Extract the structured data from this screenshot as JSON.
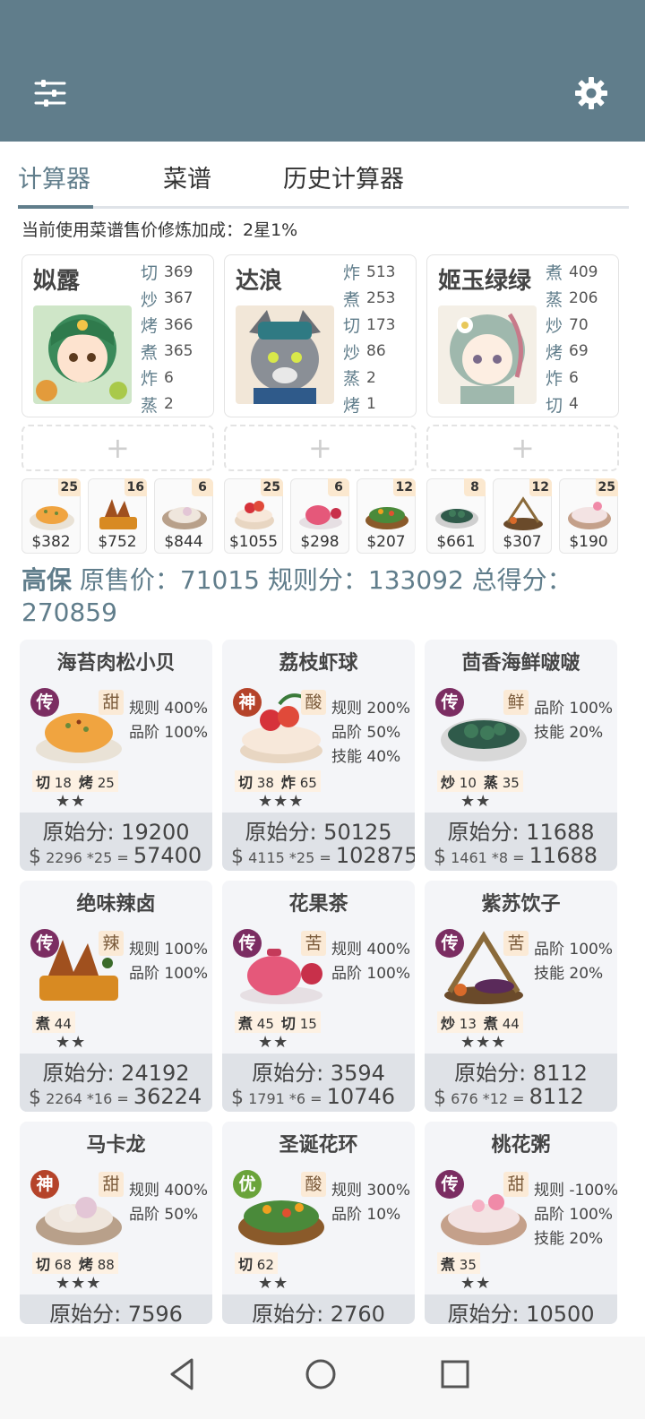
{
  "tabs": [
    "计算器",
    "菜谱",
    "历史计算器"
  ],
  "bonus_text": "当前使用菜谱售价修炼加成：2星1%",
  "chefs": [
    {
      "name": "姒露",
      "stats": [
        [
          "切",
          "369"
        ],
        [
          "炒",
          "367"
        ],
        [
          "烤",
          "366"
        ],
        [
          "煮",
          "365"
        ],
        [
          "炸",
          "6"
        ],
        [
          "蒸",
          "2"
        ]
      ]
    },
    {
      "name": "达浪",
      "stats": [
        [
          "炸",
          "513"
        ],
        [
          "煮",
          "253"
        ],
        [
          "切",
          "173"
        ],
        [
          "炒",
          "86"
        ],
        [
          "蒸",
          "2"
        ],
        [
          "烤",
          "1"
        ]
      ]
    },
    {
      "name": "姬玉绿绿",
      "stats": [
        [
          "煮",
          "409"
        ],
        [
          "蒸",
          "206"
        ],
        [
          "炒",
          "70"
        ],
        [
          "烤",
          "69"
        ],
        [
          "炸",
          "6"
        ],
        [
          "切",
          "4"
        ]
      ]
    }
  ],
  "dishes": [
    {
      "qty": "25",
      "price": "$382"
    },
    {
      "qty": "16",
      "price": "$752"
    },
    {
      "qty": "6",
      "price": "$844"
    },
    {
      "qty": "25",
      "price": "$1055"
    },
    {
      "qty": "6",
      "price": "$298"
    },
    {
      "qty": "12",
      "price": "$207"
    },
    {
      "qty": "8",
      "price": "$661"
    },
    {
      "qty": "12",
      "price": "$307"
    },
    {
      "qty": "25",
      "price": "$190"
    }
  ],
  "summary": {
    "bold": "高保",
    "text": " 原售价：71015 规则分：133092 总得分：270859"
  },
  "recipes": [
    {
      "title": "海苔肉松小贝",
      "rarity": "传",
      "taste": "甜",
      "lines": [
        "规则 400%",
        "品阶 100%"
      ],
      "req": [
        [
          "切",
          "18"
        ],
        [
          "烤",
          "25"
        ]
      ],
      "stars": "★★",
      "orig": "原始分: 19200",
      "unit": "2296 *25",
      "total": "57400"
    },
    {
      "title": "荔枝虾球",
      "rarity": "神",
      "taste": "酸",
      "lines": [
        "规则 200%",
        "品阶 50%",
        "技能 40%"
      ],
      "req": [
        [
          "切",
          "38"
        ],
        [
          "炸",
          "65"
        ]
      ],
      "stars": "★★★",
      "orig": "原始分: 50125",
      "unit": "4115 *25",
      "total": "102875"
    },
    {
      "title": "茴香海鲜啵啵",
      "rarity": "传",
      "taste": "鲜",
      "lines": [
        "品阶 100%",
        "技能 20%"
      ],
      "req": [
        [
          "炒",
          "10"
        ],
        [
          "蒸",
          "35"
        ]
      ],
      "stars": "★★",
      "orig": "原始分: 11688",
      "unit": "1461 *8",
      "total": "11688"
    },
    {
      "title": "绝味辣卤",
      "rarity": "传",
      "taste": "辣",
      "lines": [
        "规则 100%",
        "品阶 100%"
      ],
      "req": [
        [
          "煮",
          "44"
        ]
      ],
      "stars": "★★",
      "orig": "原始分: 24192",
      "unit": "2264 *16",
      "total": "36224"
    },
    {
      "title": "花果茶",
      "rarity": "传",
      "taste": "苦",
      "lines": [
        "规则 400%",
        "品阶 100%"
      ],
      "req": [
        [
          "煮",
          "45"
        ],
        [
          "切",
          "15"
        ]
      ],
      "stars": "★★",
      "orig": "原始分: 3594",
      "unit": "1791 *6",
      "total": "10746"
    },
    {
      "title": "紫苏饮子",
      "rarity": "传",
      "taste": "苦",
      "lines": [
        "品阶 100%",
        "技能 20%"
      ],
      "req": [
        [
          "炒",
          "13"
        ],
        [
          "煮",
          "44"
        ]
      ],
      "stars": "★★★",
      "orig": "原始分: 8112",
      "unit": "676 *12",
      "total": "8112"
    },
    {
      "title": "马卡龙",
      "rarity": "神",
      "taste": "甜",
      "lines": [
        "规则 400%",
        "品阶 50%"
      ],
      "req": [
        [
          "切",
          "68"
        ],
        [
          "烤",
          "88"
        ]
      ],
      "stars": "★★★",
      "orig": "原始分: 7596",
      "unit": "",
      "total": ""
    },
    {
      "title": "圣诞花环",
      "rarity": "优",
      "taste": "酸",
      "lines": [
        "规则 300%",
        "品阶 10%"
      ],
      "req": [
        [
          "切",
          "62"
        ]
      ],
      "stars": "★★",
      "orig": "原始分: 2760",
      "unit": "",
      "total": ""
    },
    {
      "title": "桃花粥",
      "rarity": "传",
      "taste": "甜",
      "lines": [
        "规则 -100%",
        "品阶 100%",
        "技能 20%"
      ],
      "req": [
        [
          "煮",
          "35"
        ]
      ],
      "stars": "★★",
      "orig": "原始分: 10500",
      "unit": "",
      "total": ""
    }
  ],
  "colors": {
    "primary": "#607d8b",
    "legend": "#7b2d62",
    "god": "#b5432a",
    "good": "#6aa33a"
  }
}
